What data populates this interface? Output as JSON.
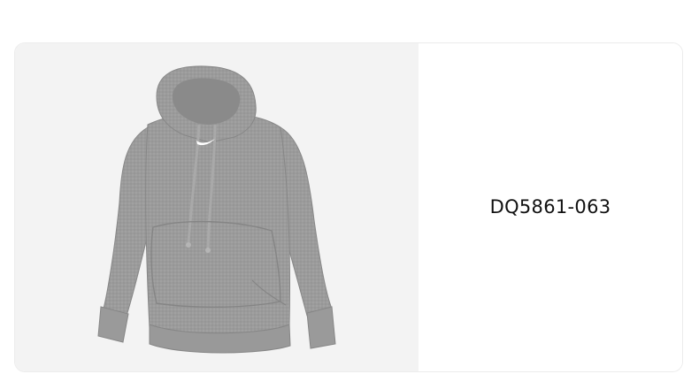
{
  "product": {
    "code": "DQ5861-063",
    "image_subject": "grey-hoodie",
    "colors": {
      "hoodie": "#9a9a9a",
      "hoodie_shadow": "#7f7f7f",
      "hoodie_light": "#acacac",
      "logo": "#ffffff",
      "image_background": "#f3f3f3"
    }
  }
}
